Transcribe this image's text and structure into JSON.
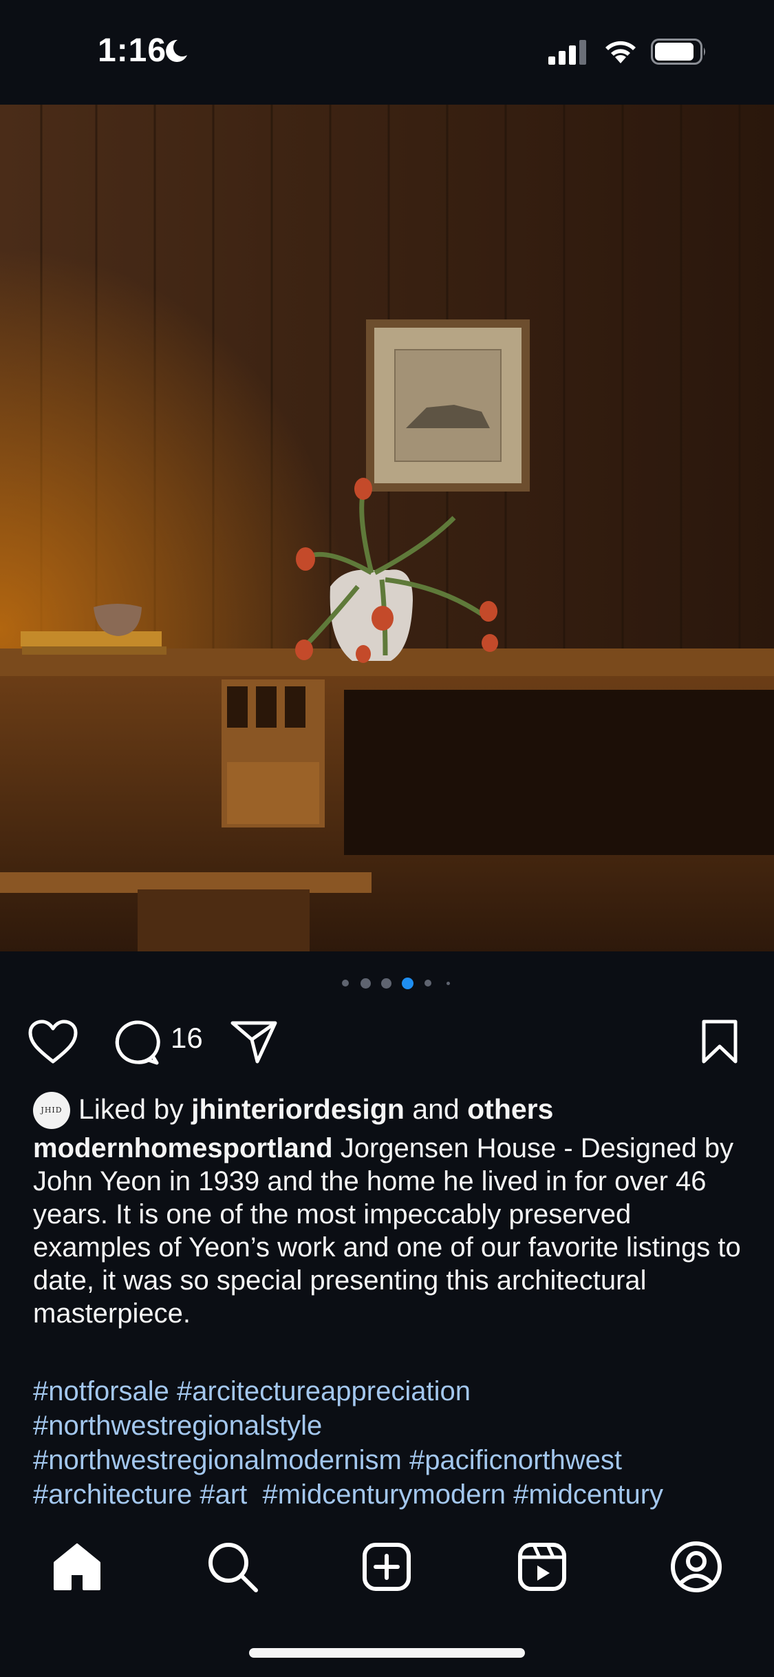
{
  "status_bar": {
    "time": "1:16",
    "icons": [
      "moon-icon",
      "cellular-signal-icon",
      "wifi-icon",
      "battery-icon"
    ]
  },
  "post": {
    "image_description_icon": "post-photo",
    "carousel": {
      "count": 6,
      "active_index": 3,
      "accent": "#1f8ef1"
    },
    "actions": {
      "comment_count": "16",
      "icons": [
        "heart-icon",
        "comment-icon",
        "share-icon",
        "bookmark-icon"
      ]
    },
    "liked_by": {
      "avatar_text": "JHID",
      "prefix": "Liked by ",
      "user": "jhinteriordesign",
      "middle": " and ",
      "others": "others"
    },
    "caption": {
      "username": "modernhomesportland",
      "text": " Jorgensen House - Designed by John Yeon in 1939 and the home he lived in for over 46 years. It is one of the most impeccably preserved examples of Yeon’s work and one of our favorite listings to date, it was so special presenting this architectural masterpiece."
    },
    "hashtags": {
      "t1": "#notforsale",
      "t2": "#arcitectureappreciation",
      "t3": "#northwestregionalstyle",
      "t4": "#northwestregionalmodernism",
      "t5": "#pacificnorthwest",
      "t6": "#architecture",
      "t7": "#art",
      "t8": "#midcenturymodern",
      "t9": "#midcentury",
      "color": "#a3c7ee"
    }
  },
  "tab_bar": {
    "icons": [
      "home-icon",
      "search-icon",
      "create-icon",
      "reels-icon",
      "profile-icon"
    ]
  }
}
